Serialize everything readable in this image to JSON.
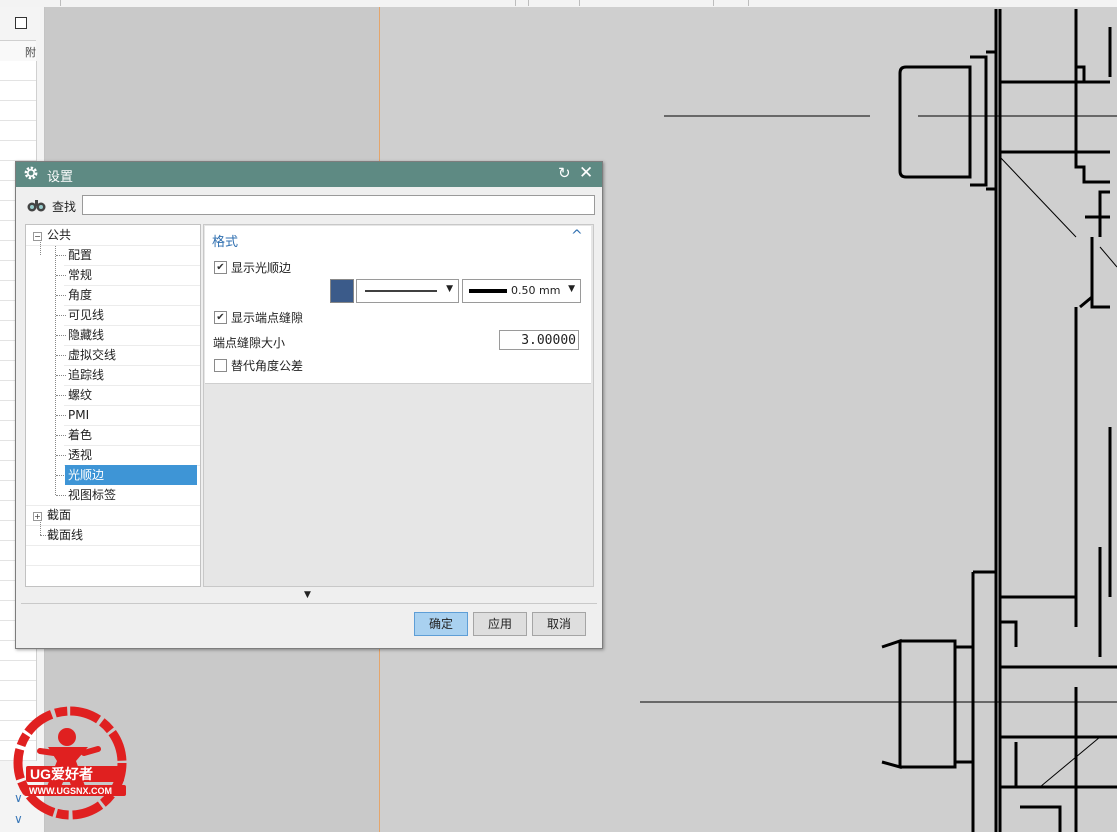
{
  "left_panel": {
    "header_label": "附"
  },
  "dialog": {
    "title": "设置",
    "reset_glyph": "↻",
    "close_glyph": "✕",
    "search": {
      "label": "查找",
      "value": ""
    },
    "tree": {
      "items": [
        {
          "label": "公共",
          "expander": "−"
        },
        {
          "label": "配置"
        },
        {
          "label": "常规"
        },
        {
          "label": "角度"
        },
        {
          "label": "可见线"
        },
        {
          "label": "隐藏线"
        },
        {
          "label": "虚拟交线"
        },
        {
          "label": "追踪线"
        },
        {
          "label": "螺纹"
        },
        {
          "label": "PMI"
        },
        {
          "label": "着色"
        },
        {
          "label": "透视"
        },
        {
          "label": "光顺边",
          "selected": true
        },
        {
          "label": "视图标签"
        },
        {
          "label": "截面",
          "expander": "+"
        },
        {
          "label": "截面线"
        }
      ]
    },
    "section": {
      "title": "格式",
      "collapse_glyph": "^",
      "show_smooth_edges": {
        "label": "显示光顺边",
        "checked": true
      },
      "color": "#3b5b8a",
      "line_width": "0.50 mm",
      "show_end_gaps": {
        "label": "显示端点缝隙",
        "checked": true
      },
      "gap_size": {
        "label": "端点缝隙大小",
        "value": "3.00000"
      },
      "alt_angle_tolerance": {
        "label": "替代角度公差",
        "checked": false
      }
    },
    "buttons": {
      "ok": "确定",
      "apply": "应用",
      "cancel": "取消"
    }
  },
  "watermark": {
    "brand": "UG爱好者",
    "url": "WWW.UGSNX.COM"
  }
}
